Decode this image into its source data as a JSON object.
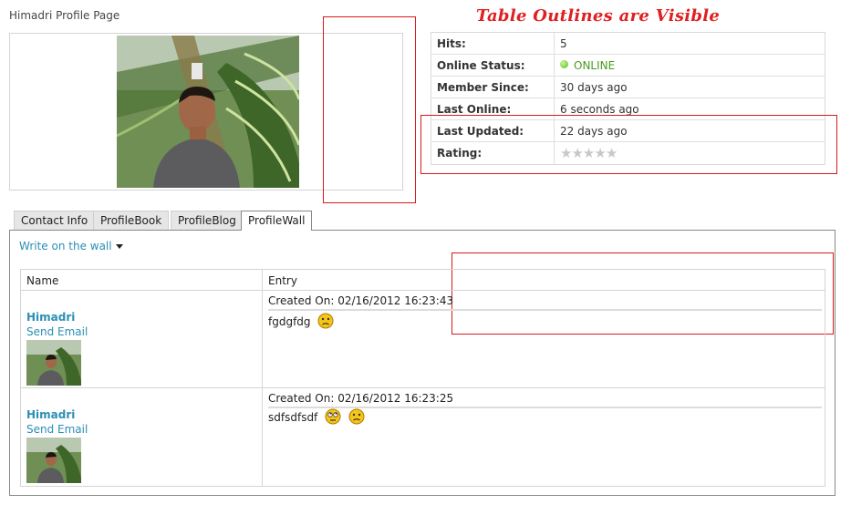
{
  "page": {
    "title": "Himadri Profile Page",
    "annotation": "Table Outlines are Visible"
  },
  "info": {
    "rows": [
      {
        "label": "Hits:",
        "value": "5"
      },
      {
        "label": "Online Status:",
        "value": "ONLINE"
      },
      {
        "label": "Member Since:",
        "value": "30 days ago"
      },
      {
        "label": "Last Online:",
        "value": "6 seconds ago"
      },
      {
        "label": "Last Updated:",
        "value": "22 days ago"
      },
      {
        "label": "Rating:",
        "stars": 0,
        "max_stars": 5
      }
    ]
  },
  "tabs": [
    {
      "label": "Contact Info",
      "active": false
    },
    {
      "label": "ProfileBook",
      "active": false
    },
    {
      "label": "ProfileBlog",
      "active": false
    },
    {
      "label": "ProfileWall",
      "active": true
    }
  ],
  "wall": {
    "write_label": "Write on the wall",
    "columns": [
      "Name",
      "Entry"
    ],
    "entries": [
      {
        "author": "Himadri",
        "email_label": "Send Email",
        "created": "Created On: 02/16/2012 16:23:43",
        "text": "fgdgfdg",
        "smileys": [
          "sad-smiley-icon"
        ]
      },
      {
        "author": "Himadri",
        "email_label": "Send Email",
        "created": "Created On: 02/16/2012 16:23:25",
        "text": "sdfsdfsdf",
        "smileys": [
          "rolling-eyes-smiley-icon",
          "sad-smiley-icon"
        ]
      }
    ]
  },
  "colors": {
    "link": "#2a8fb4",
    "online": "#4c9a1f",
    "annotation_red": "#e02020"
  }
}
